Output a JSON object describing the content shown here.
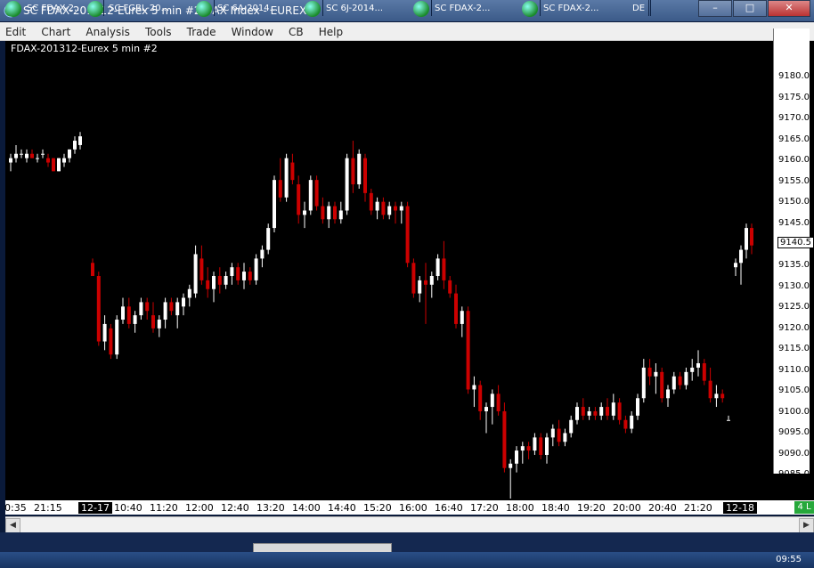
{
  "window": {
    "title": "SC FDAX-201312-Eurex  5 min  #2  DAX Index - EUREX",
    "buttons": [
      "–",
      "□",
      "✕"
    ]
  },
  "menu": [
    "Edit",
    "Chart",
    "Analysis",
    "Tools",
    "Trade",
    "Window",
    "CB",
    "Help"
  ],
  "chart": {
    "label": "FDAX-201312-Eurex  5 min  #2",
    "last_price": "9140.5",
    "bottom_right_badge": "4 L",
    "up_color": "#ffffff",
    "down_color": "#cc0000"
  },
  "y_ticks": [
    "9180.0",
    "9175.0",
    "9170.0",
    "9165.0",
    "9160.0",
    "9155.0",
    "9150.0",
    "9145.0",
    "9140.0",
    "9135.0",
    "9130.0",
    "9125.0",
    "9120.0",
    "9115.0",
    "9110.0",
    "9105.0",
    "9100.0",
    "9095.0",
    "9090.0",
    "9085.0"
  ],
  "x_ticks": [
    "0:35",
    "21:15",
    "12-17",
    "10:40",
    "11:20",
    "12:00",
    "12:40",
    "13:20",
    "14:00",
    "14:40",
    "15:20",
    "16:00",
    "16:40",
    "17:20",
    "18:00",
    "18:40",
    "19:20",
    "20:00",
    "20:40",
    "21:20",
    "12-18"
  ],
  "taskbar": {
    "items": [
      "SC FDAX-2...",
      "SC FGBL-20...",
      "SC 6A-2014...",
      "SC 6J-2014...",
      "SC FDAX-2...",
      "SC FDAX-2..."
    ],
    "lang": "DE",
    "clock": "09:55"
  },
  "chart_data": {
    "type": "candlestick",
    "y_range": [
      9082,
      9184
    ],
    "candles": [
      [
        9159,
        9161,
        9157,
        9160
      ],
      [
        9160,
        9163,
        9159,
        9161
      ],
      [
        9161,
        9162,
        9160,
        9161
      ],
      [
        9160,
        9162,
        9159,
        9161
      ],
      [
        9161,
        9162,
        9160,
        9160
      ],
      [
        9160,
        9161,
        9159,
        9160
      ],
      [
        9161,
        9162,
        9160,
        9161
      ],
      [
        9160,
        9161,
        9158,
        9159
      ],
      [
        9160,
        9160,
        9157,
        9157
      ],
      [
        9157,
        9160,
        9157,
        9160
      ],
      [
        9159,
        9161,
        9158,
        9160
      ],
      [
        9160,
        9162,
        9159,
        9162
      ],
      [
        9162,
        9165,
        9161,
        9164
      ],
      [
        9163,
        9166,
        9162,
        9165
      ],
      [
        9136,
        9137,
        9133,
        9133
      ],
      [
        9133,
        9134,
        9117,
        9118
      ],
      [
        9118,
        9124,
        9116,
        9122
      ],
      [
        9121,
        9122,
        9114,
        9115
      ],
      [
        9115,
        9124,
        9114,
        9123
      ],
      [
        9123,
        9128,
        9122,
        9126
      ],
      [
        9126,
        9128,
        9121,
        9122
      ],
      [
        9122,
        9125,
        9120,
        9124
      ],
      [
        9124,
        9128,
        9123,
        9127
      ],
      [
        9127,
        9128,
        9123,
        9125
      ],
      [
        9124,
        9127,
        9120,
        9121
      ],
      [
        9121,
        9124,
        9119,
        9123
      ],
      [
        9123,
        9128,
        9121,
        9127
      ],
      [
        9127,
        9128,
        9124,
        9125
      ],
      [
        9124,
        9128,
        9121,
        9127
      ],
      [
        9126,
        9129,
        9124,
        9128
      ],
      [
        9128,
        9131,
        9126,
        9130
      ],
      [
        9129,
        9140,
        9128,
        9138
      ],
      [
        9137,
        9140,
        9131,
        9132
      ],
      [
        9132,
        9135,
        9128,
        9130
      ],
      [
        9130,
        9134,
        9127,
        9133
      ],
      [
        9133,
        9135,
        9129,
        9131
      ],
      [
        9131,
        9134,
        9130,
        9133
      ],
      [
        9133,
        9136,
        9131,
        9135
      ],
      [
        9135,
        9136,
        9131,
        9132
      ],
      [
        9132,
        9136,
        9130,
        9134
      ],
      [
        9134,
        9135,
        9131,
        9132
      ],
      [
        9132,
        9138,
        9131,
        9137
      ],
      [
        9137,
        9140,
        9135,
        9139
      ],
      [
        9139,
        9145,
        9138,
        9144
      ],
      [
        9144,
        9156,
        9143,
        9155
      ],
      [
        9155,
        9160,
        9150,
        9151
      ],
      [
        9151,
        9161,
        9150,
        9160
      ],
      [
        9159,
        9161,
        9154,
        9155
      ],
      [
        9154,
        9156,
        9145,
        9147
      ],
      [
        9147,
        9150,
        9144,
        9148
      ],
      [
        9148,
        9156,
        9147,
        9155
      ],
      [
        9155,
        9156,
        9148,
        9149
      ],
      [
        9149,
        9151,
        9145,
        9146
      ],
      [
        9146,
        9150,
        9144,
        9149
      ],
      [
        9149,
        9150,
        9145,
        9146
      ],
      [
        9146,
        9150,
        9145,
        9148
      ],
      [
        9148,
        9161,
        9147,
        9160
      ],
      [
        9160,
        9164,
        9152,
        9154
      ],
      [
        9154,
        9162,
        9153,
        9161
      ],
      [
        9160,
        9161,
        9150,
        9152
      ],
      [
        9152,
        9153,
        9147,
        9148
      ],
      [
        9148,
        9151,
        9146,
        9150
      ],
      [
        9150,
        9151,
        9146,
        9147
      ],
      [
        9147,
        9150,
        9146,
        9149
      ],
      [
        9149,
        9150,
        9145,
        9148
      ],
      [
        9148,
        9150,
        9145,
        9149
      ],
      [
        9149,
        9150,
        9135,
        9136
      ],
      [
        9136,
        9137,
        9128,
        9129
      ],
      [
        9129,
        9133,
        9127,
        9132
      ],
      [
        9132,
        9136,
        9122,
        9131
      ],
      [
        9131,
        9134,
        9128,
        9133
      ],
      [
        9133,
        9138,
        9132,
        9137
      ],
      [
        9137,
        9141,
        9130,
        9132
      ],
      [
        9132,
        9133,
        9128,
        9129
      ],
      [
        9129,
        9131,
        9121,
        9122
      ],
      [
        9122,
        9126,
        9119,
        9125
      ],
      [
        9125,
        9126,
        9106,
        9107
      ],
      [
        9107,
        9110,
        9103,
        9108
      ],
      [
        9108,
        9109,
        9100,
        9102
      ],
      [
        9102,
        9104,
        9097,
        9103
      ],
      [
        9103,
        9107,
        9099,
        9106
      ],
      [
        9106,
        9108,
        9101,
        9102
      ],
      [
        9102,
        9104,
        9088,
        9089
      ],
      [
        9089,
        9091,
        9082,
        9090
      ],
      [
        9090,
        9094,
        9088,
        9093
      ],
      [
        9093,
        9095,
        9090,
        9094
      ],
      [
        9094,
        9095,
        9091,
        9093
      ],
      [
        9093,
        9097,
        9092,
        9096
      ],
      [
        9096,
        9097,
        9091,
        9092
      ],
      [
        9092,
        9097,
        9090,
        9096
      ],
      [
        9096,
        9099,
        9094,
        9098
      ],
      [
        9098,
        9100,
        9094,
        9095
      ],
      [
        9095,
        9098,
        9094,
        9097
      ],
      [
        9097,
        9101,
        9096,
        9100
      ],
      [
        9100,
        9104,
        9099,
        9103
      ],
      [
        9103,
        9105,
        9100,
        9101
      ],
      [
        9101,
        9103,
        9100,
        9102
      ],
      [
        9102,
        9103,
        9100,
        9101
      ],
      [
        9101,
        9104,
        9100,
        9103
      ],
      [
        9103,
        9105,
        9100,
        9101
      ],
      [
        9101,
        9106,
        9100,
        9104
      ],
      [
        9104,
        9105,
        9099,
        9100
      ],
      [
        9100,
        9101,
        9097,
        9098
      ],
      [
        9098,
        9102,
        9097,
        9101
      ],
      [
        9101,
        9106,
        9100,
        9105
      ],
      [
        9105,
        9114,
        9104,
        9112
      ],
      [
        9112,
        9114,
        9108,
        9110
      ],
      [
        9110,
        9113,
        9106,
        9111
      ],
      [
        9111,
        9112,
        9104,
        9105
      ],
      [
        9105,
        9108,
        9103,
        9107
      ],
      [
        9107,
        9111,
        9106,
        9110
      ],
      [
        9110,
        9111,
        9107,
        9108
      ],
      [
        9108,
        9112,
        9107,
        9111
      ],
      [
        9111,
        9114,
        9109,
        9112
      ],
      [
        9112,
        9116,
        9110,
        9113
      ],
      [
        9113,
        9114,
        9108,
        9109
      ],
      [
        9109,
        9112,
        9104,
        9105
      ],
      [
        9105,
        9108,
        9103,
        9106
      ],
      [
        9106,
        9107,
        9104,
        9105
      ],
      [
        9100,
        9101,
        9100,
        9100
      ],
      [
        9135,
        9137,
        9133,
        9136
      ],
      [
        9136,
        9140,
        9131,
        9139
      ],
      [
        9139,
        9145,
        9137,
        9144
      ],
      [
        9144,
        9145,
        9138,
        9140
      ]
    ]
  }
}
